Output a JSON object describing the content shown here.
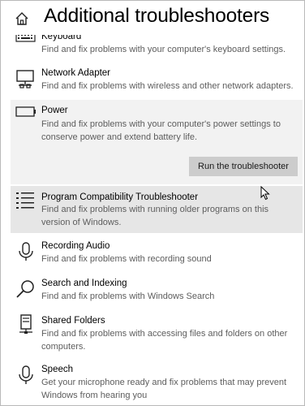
{
  "page": {
    "title": "Additional troubleshooters",
    "home_icon": "home-icon"
  },
  "troubleshooters": [
    {
      "title": "Keyboard",
      "description": "Find and fix problems with your computer's keyboard settings.",
      "icon": "keyboard-icon"
    },
    {
      "title": "Network Adapter",
      "description": "Find and fix problems with wireless and other network adapters.",
      "icon": "network-adapter-icon"
    },
    {
      "title": "Power",
      "description": "Find and fix problems with your computer's power settings to conserve power and extend battery life.",
      "icon": "battery-icon",
      "expanded": true,
      "button_label": "Run the troubleshooter"
    },
    {
      "title": "Program Compatibility Troubleshooter",
      "description": "Find and fix problems with running older programs on this version of Windows.",
      "icon": "list-icon",
      "hovered": true
    },
    {
      "title": "Recording Audio",
      "description": "Find and fix problems with recording sound",
      "icon": "microphone-icon"
    },
    {
      "title": "Search and Indexing",
      "description": "Find and fix problems with Windows Search",
      "icon": "search-icon"
    },
    {
      "title": "Shared Folders",
      "description": "Find and fix problems with accessing files and folders on other computers.",
      "icon": "shared-folder-icon"
    },
    {
      "title": "Speech",
      "description": "Get your microphone ready and fix problems that may prevent Windows from hearing you",
      "icon": "microphone-icon"
    }
  ],
  "colors": {
    "expanded_background": "#f2f2f2",
    "hover_background": "#e6e6e6",
    "button_background": "#cccccc",
    "description_text": "#5d5d5d"
  }
}
